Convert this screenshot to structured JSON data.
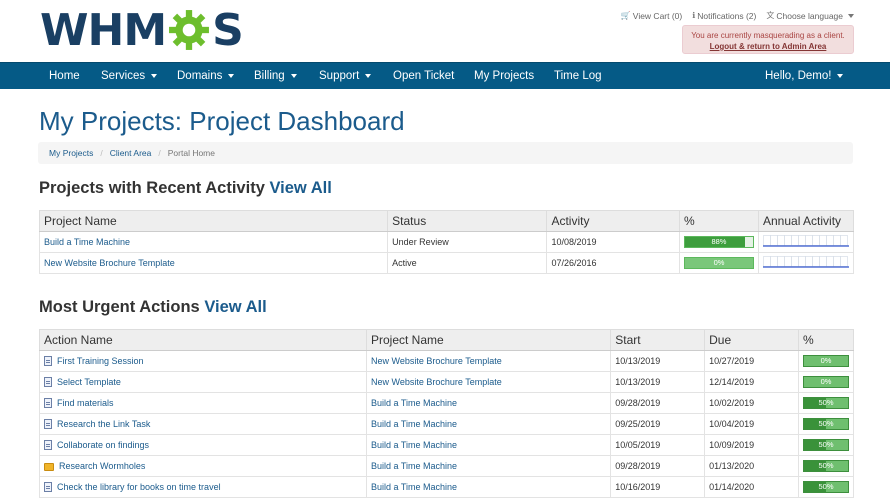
{
  "header": {
    "logo_left": "WHM",
    "logo_right": "S",
    "view_cart": "View Cart (0)",
    "notifications": "Notifications (2)",
    "language": "Choose language",
    "masquerade_text": "You are currently masquerading as a client.",
    "masquerade_return": "Logout & return to Admin Area"
  },
  "nav": {
    "home": "Home",
    "services": "Services",
    "domains": "Domains",
    "billing": "Billing",
    "support": "Support",
    "open_ticket": "Open Ticket",
    "my_projects": "My Projects",
    "time_log": "Time Log",
    "user": "Hello, Demo!"
  },
  "page": {
    "title": "My Projects: Project Dashboard",
    "breadcrumb": [
      "My Projects",
      "Client Area",
      "Portal Home"
    ]
  },
  "recent": {
    "title": "Projects with Recent Activity",
    "view_all": "View All",
    "headers": [
      "Project Name",
      "Status",
      "Activity",
      "%",
      "Annual Activity"
    ],
    "rows": [
      {
        "name": "Build a Time Machine",
        "status": "Under Review",
        "activity": "10/08/2019",
        "percent": 88,
        "percent_label": "88%"
      },
      {
        "name": "New Website Brochure Template",
        "status": "Active",
        "activity": "07/26/2016",
        "percent": 0,
        "percent_label": "0%"
      }
    ]
  },
  "urgent": {
    "title": "Most Urgent Actions",
    "view_all": "View All",
    "headers": [
      "Action Name",
      "Project Name",
      "Start",
      "Due",
      "%"
    ],
    "rows": [
      {
        "icon": "document-icon",
        "action": "First Training Session",
        "project": "New Website Brochure Template",
        "start": "10/13/2019",
        "due": "10/27/2019",
        "percent": 0,
        "percent_label": "0%"
      },
      {
        "icon": "document-icon",
        "action": "Select Template",
        "project": "New Website Brochure Template",
        "start": "10/13/2019",
        "due": "12/14/2019",
        "percent": 0,
        "percent_label": "0%"
      },
      {
        "icon": "document-icon",
        "action": "Find materials",
        "project": "Build a Time Machine",
        "start": "09/28/2019",
        "due": "10/02/2019",
        "percent": 50,
        "percent_label": "50%"
      },
      {
        "icon": "document-icon",
        "action": "Research the Link Task",
        "project": "Build a Time Machine",
        "start": "09/25/2019",
        "due": "10/04/2019",
        "percent": 50,
        "percent_label": "50%"
      },
      {
        "icon": "document-icon",
        "action": "Collaborate on findings",
        "project": "Build a Time Machine",
        "start": "10/05/2019",
        "due": "10/09/2019",
        "percent": 50,
        "percent_label": "50%"
      },
      {
        "icon": "folder-icon",
        "action": "Research Wormholes",
        "project": "Build a Time Machine",
        "start": "09/28/2019",
        "due": "01/13/2020",
        "percent": 50,
        "percent_label": "50%"
      },
      {
        "icon": "document-icon",
        "action": "Check the library for books on time travel",
        "project": "Build a Time Machine",
        "start": "10/16/2019",
        "due": "01/14/2020",
        "percent": 50,
        "percent_label": "50%"
      }
    ]
  },
  "colors": {
    "brand": "#1a3f63",
    "accent_green": "#6dbe2d",
    "nav_bg": "#055a86",
    "link": "#1b5b8c"
  }
}
